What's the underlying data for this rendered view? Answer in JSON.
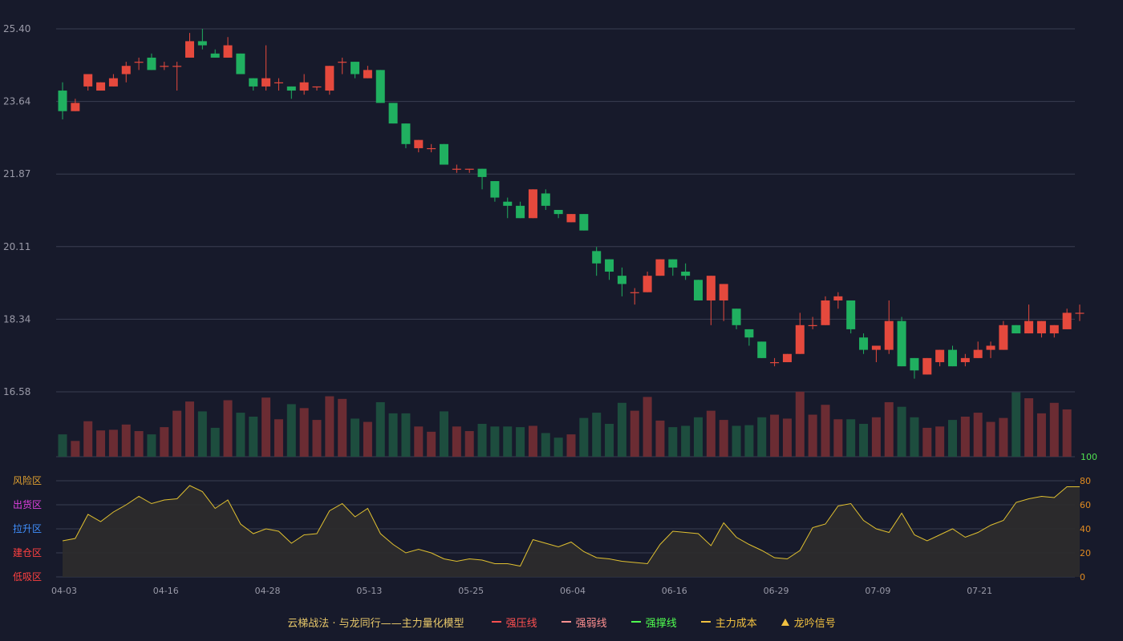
{
  "colors": {
    "background": "#171a2b",
    "grid": "#3a3e52",
    "up": "#e5493d",
    "down": "#20b060",
    "vol_up": "#6b2c33",
    "vol_down": "#1d4d3e",
    "osc_line": "#e0c030",
    "osc_fill": "#2e2c2c",
    "axis_text": "#9a9aa8",
    "right_axis_text": "#e08a20",
    "vol_max_text": "#50e050"
  },
  "legend": {
    "title": "云梯战法 · 与龙同行——主力量化模型",
    "items": [
      {
        "label": "强压线",
        "color": "#ff5050",
        "style": "solid"
      },
      {
        "label": "强弱线",
        "color": "#ff9090",
        "style": "dash"
      },
      {
        "label": "强撑线",
        "color": "#50ff50",
        "style": "solid"
      },
      {
        "label": "主力成本",
        "color": "#f0c040",
        "style": "dash"
      },
      {
        "label": "龙吟信号",
        "color": "#f0c040",
        "style": "triangle"
      }
    ]
  },
  "zones": [
    {
      "label": "风险区",
      "color": "#e0a030"
    },
    {
      "label": "出货区",
      "color": "#e040e0"
    },
    {
      "label": "拉升区",
      "color": "#4090ff"
    },
    {
      "label": "建仓区",
      "color": "#ff4040"
    },
    {
      "label": "低吸区",
      "color": "#ff4040"
    }
  ],
  "chart_data": {
    "type": "candlestick",
    "price_axis": {
      "ticks": [
        "25.40",
        "23.64",
        "21.87",
        "20.11",
        "18.34",
        "16.58"
      ],
      "range": [
        16.58,
        25.4
      ]
    },
    "volume_axis": {
      "max_label": "100"
    },
    "osc_axis": {
      "ticks": [
        "0",
        "20",
        "40",
        "60",
        "80"
      ],
      "range": [
        0,
        100
      ]
    },
    "x_labels": [
      {
        "i": 0,
        "label": "04-03"
      },
      {
        "i": 8,
        "label": "04-16"
      },
      {
        "i": 16,
        "label": "04-28"
      },
      {
        "i": 24,
        "label": "05-13"
      },
      {
        "i": 32,
        "label": "05-25"
      },
      {
        "i": 40,
        "label": "06-04"
      },
      {
        "i": 48,
        "label": "06-16"
      },
      {
        "i": 56,
        "label": "06-29"
      },
      {
        "i": 64,
        "label": "07-09"
      },
      {
        "i": 72,
        "label": "07-21"
      }
    ],
    "candles": [
      [
        23.9,
        23.4,
        24.1,
        23.2
      ],
      [
        23.4,
        23.6,
        23.7,
        23.4
      ],
      [
        24.0,
        24.3,
        24.3,
        23.9
      ],
      [
        23.9,
        24.1,
        24.1,
        23.9
      ],
      [
        24.0,
        24.2,
        24.3,
        24.0
      ],
      [
        24.3,
        24.5,
        24.6,
        24.1
      ],
      [
        24.6,
        24.6,
        24.7,
        24.4
      ],
      [
        24.7,
        24.4,
        24.8,
        24.4
      ],
      [
        24.5,
        24.5,
        24.6,
        24.4
      ],
      [
        24.5,
        24.5,
        24.6,
        23.9
      ],
      [
        24.7,
        25.1,
        25.3,
        24.7
      ],
      [
        25.1,
        25.0,
        25.4,
        24.9
      ],
      [
        24.8,
        24.7,
        24.9,
        24.7
      ],
      [
        24.7,
        25.0,
        25.2,
        24.7
      ],
      [
        24.8,
        24.3,
        24.8,
        24.3
      ],
      [
        24.2,
        24.0,
        24.2,
        23.9
      ],
      [
        24.0,
        24.2,
        25.0,
        23.9
      ],
      [
        24.1,
        24.1,
        24.2,
        23.9
      ],
      [
        24.0,
        23.9,
        24.0,
        23.7
      ],
      [
        23.9,
        24.1,
        24.3,
        23.8
      ],
      [
        24.0,
        24.0,
        24.0,
        23.9
      ],
      [
        23.9,
        24.5,
        24.5,
        23.8
      ],
      [
        24.6,
        24.6,
        24.7,
        24.3
      ],
      [
        24.6,
        24.3,
        24.6,
        24.2
      ],
      [
        24.2,
        24.4,
        24.5,
        24.2
      ],
      [
        24.4,
        23.6,
        24.4,
        23.6
      ],
      [
        23.6,
        23.1,
        23.6,
        23.1
      ],
      [
        23.1,
        22.6,
        23.1,
        22.5
      ],
      [
        22.5,
        22.7,
        22.7,
        22.4
      ],
      [
        22.5,
        22.5,
        22.6,
        22.4
      ],
      [
        22.6,
        22.1,
        22.6,
        22.1
      ],
      [
        22.0,
        22.0,
        22.1,
        21.9
      ],
      [
        22.0,
        22.0,
        22.0,
        21.9
      ],
      [
        22.0,
        21.8,
        22.0,
        21.5
      ],
      [
        21.7,
        21.3,
        21.7,
        21.2
      ],
      [
        21.2,
        21.1,
        21.3,
        20.8
      ],
      [
        21.1,
        20.8,
        21.2,
        20.8
      ],
      [
        20.8,
        21.5,
        21.5,
        20.8
      ],
      [
        21.4,
        21.1,
        21.5,
        21.0
      ],
      [
        21.0,
        20.9,
        21.0,
        20.8
      ],
      [
        20.7,
        20.9,
        20.9,
        20.7
      ],
      [
        20.9,
        20.5,
        20.9,
        20.5
      ],
      [
        20.0,
        19.7,
        20.1,
        19.4
      ],
      [
        19.8,
        19.5,
        19.8,
        19.3
      ],
      [
        19.4,
        19.2,
        19.6,
        18.9
      ],
      [
        19.0,
        19.0,
        19.1,
        18.7
      ],
      [
        19.0,
        19.4,
        19.5,
        19.0
      ],
      [
        19.4,
        19.8,
        19.8,
        19.4
      ],
      [
        19.8,
        19.6,
        19.8,
        19.4
      ],
      [
        19.5,
        19.4,
        19.7,
        19.3
      ],
      [
        19.3,
        18.8,
        19.3,
        18.8
      ],
      [
        18.8,
        19.4,
        19.4,
        18.2
      ],
      [
        18.8,
        19.2,
        19.2,
        18.3
      ],
      [
        18.6,
        18.2,
        18.6,
        18.1
      ],
      [
        18.1,
        17.9,
        18.1,
        17.7
      ],
      [
        17.8,
        17.4,
        17.8,
        17.4
      ],
      [
        17.3,
        17.3,
        17.4,
        17.2
      ],
      [
        17.3,
        17.5,
        17.5,
        17.3
      ],
      [
        17.5,
        18.2,
        18.5,
        17.5
      ],
      [
        18.2,
        18.2,
        18.4,
        18.1
      ],
      [
        18.2,
        18.8,
        18.9,
        18.2
      ],
      [
        18.8,
        18.9,
        19.0,
        18.6
      ],
      [
        18.8,
        18.1,
        18.8,
        18.0
      ],
      [
        17.9,
        17.6,
        18.0,
        17.5
      ],
      [
        17.6,
        17.7,
        17.7,
        17.3
      ],
      [
        17.6,
        18.3,
        18.8,
        17.5
      ],
      [
        18.3,
        17.2,
        18.4,
        17.2
      ],
      [
        17.4,
        17.1,
        17.4,
        16.9
      ],
      [
        17.0,
        17.4,
        17.4,
        17.0
      ],
      [
        17.3,
        17.6,
        17.6,
        17.2
      ],
      [
        17.6,
        17.2,
        17.7,
        17.2
      ],
      [
        17.3,
        17.4,
        17.5,
        17.2
      ],
      [
        17.4,
        17.6,
        17.8,
        17.4
      ],
      [
        17.6,
        17.7,
        17.8,
        17.4
      ],
      [
        17.6,
        18.2,
        18.3,
        17.6
      ],
      [
        18.2,
        18.0,
        18.2,
        18.0
      ],
      [
        18.0,
        18.3,
        18.7,
        18.0
      ],
      [
        18.0,
        18.3,
        18.3,
        17.9
      ],
      [
        18.0,
        18.2,
        18.2,
        17.9
      ],
      [
        18.1,
        18.5,
        18.6,
        18.1
      ],
      [
        18.5,
        18.5,
        18.7,
        18.3
      ]
    ],
    "volume": [
      34,
      24,
      54,
      40,
      41,
      49,
      39,
      34,
      45,
      70,
      84,
      69,
      44,
      86,
      67,
      61,
      90,
      57,
      80,
      74,
      56,
      92,
      88,
      58,
      53,
      83,
      66,
      66,
      46,
      38,
      69,
      46,
      39,
      50,
      46,
      46,
      45,
      47,
      36,
      29,
      34,
      59,
      67,
      50,
      82,
      70,
      91,
      55,
      45,
      47,
      60,
      70,
      56,
      47,
      48,
      60,
      64,
      58,
      99,
      64,
      79,
      57,
      57,
      50,
      60,
      83,
      76,
      60,
      44,
      46,
      56,
      61,
      67,
      53,
      59,
      98,
      89,
      66,
      82,
      72
    ],
    "oscillator": [
      30,
      32,
      52,
      46,
      54,
      60,
      67,
      61,
      64,
      65,
      76,
      71,
      57,
      64,
      44,
      36,
      40,
      38,
      28,
      35,
      36,
      55,
      61,
      50,
      57,
      36,
      27,
      20,
      23,
      20,
      15,
      13,
      15,
      14,
      11,
      11,
      9,
      31,
      28,
      25,
      29,
      21,
      16,
      15,
      13,
      12,
      11,
      27,
      38,
      37,
      36,
      26,
      45,
      33,
      27,
      22,
      16,
      15,
      22,
      41,
      44,
      59,
      61,
      47,
      40,
      37,
      53,
      35,
      30,
      35,
      40,
      33,
      37,
      43,
      47,
      62,
      65,
      67,
      66,
      75,
      75
    ]
  }
}
